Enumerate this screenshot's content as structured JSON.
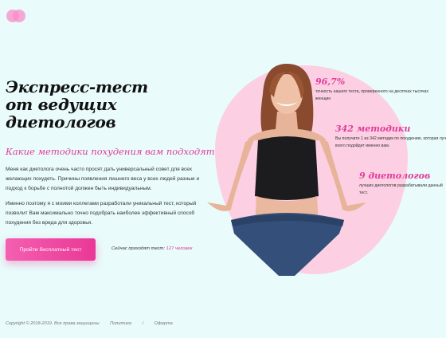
{
  "header": {
    "logo_icon": "two-overlapping-pink-circles"
  },
  "hero": {
    "title_line1": "Экспресс-тест",
    "title_line2": "от ведущих",
    "title_line3": "диетологов",
    "subtitle": "Какие методики похудения вам подходят?",
    "paragraph1": "Меня как диетолога очень часто просят дать универсальный совет для всех желающих похудеть. Причины появления лишнего веса у всех людей разные и подход к борьбе с полнотой должен быть индивидуальным.",
    "paragraph2": "Именно поэтому я с моими коллегами разработали уникальный тест, который позволит Вам максимально точно подобрать наиболее эффективный способ похудения без вреда для здоровья.",
    "cta_label": "Пройти бесплатный тест",
    "counter_prefix": "Сейчас проходят тест:",
    "counter_value": "127 человек"
  },
  "stats": [
    {
      "value": "96,7%",
      "description": "точность нашего теста, проверенного на десятках тысячах женщин"
    },
    {
      "value": "342 методики",
      "description": "Вы получите 1 из 342 методик по похудению, которая лучше всего подойдет именно вам."
    },
    {
      "value": "9 диетологов",
      "description": "лучших диетологов разрабатывали данный тест."
    }
  ],
  "footer": {
    "copyright": "Copyright © 2018-2019. Все права защищены",
    "policy": "Политика",
    "separator": "/",
    "offer": "Оферта"
  },
  "colors": {
    "background": "#e9fbfb",
    "accent": "#e13c9b",
    "blob": "#fccfe3"
  }
}
